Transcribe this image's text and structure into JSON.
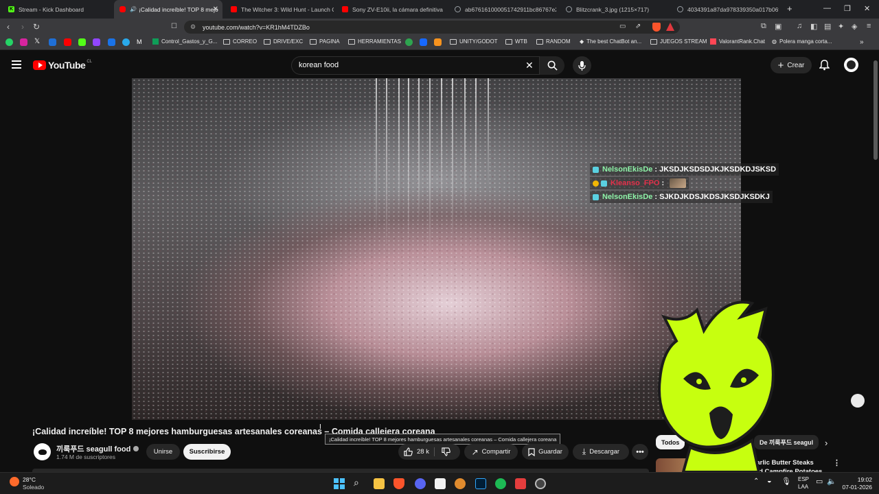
{
  "browser": {
    "tabs": [
      {
        "label": "Stream - Kick Dashboard",
        "favicon": "kick-icon",
        "color": "#53fc18"
      },
      {
        "label": "¡Calidad increíble! TOP 8 mejo",
        "favicon": "youtube-icon",
        "color": "#ff0000",
        "active": true
      },
      {
        "label": "The Witcher 3: Wild Hunt - Launch C",
        "favicon": "youtube-icon",
        "color": "#ff0000"
      },
      {
        "label": "Sony ZV-E10ii, la cámara definitiva p",
        "favicon": "youtube-icon",
        "color": "#ff0000"
      },
      {
        "label": "ab676161000051742911bc86767e2",
        "favicon": "globe-icon",
        "color": "#9aa0a6"
      },
      {
        "label": "Blitzcrank_3.jpg (1215×717)",
        "favicon": "globe-icon",
        "color": "#9aa0a6"
      },
      {
        "label": "4034391a87da978339350a017b06f",
        "favicon": "globe-icon",
        "color": "#9aa0a6"
      }
    ],
    "url": "youtube.com/watch?v=KR1hM4TDZBo",
    "bookmarks": [
      {
        "label": "Control_Gastos_y_G...",
        "type": "sheet"
      },
      {
        "label": "CORREO",
        "type": "folder"
      },
      {
        "label": "DRIVE/EXC",
        "type": "folder"
      },
      {
        "label": "PAGINA",
        "type": "folder"
      },
      {
        "label": "HERRAMIENTAS",
        "type": "folder"
      },
      {
        "label": "UNITY/GODOT",
        "type": "folder"
      },
      {
        "label": "WTB",
        "type": "folder"
      },
      {
        "label": "RANDOM",
        "type": "folder"
      },
      {
        "label": "The best ChatBot an...",
        "type": "link"
      },
      {
        "label": "JUEGOS STREAM",
        "type": "folder"
      },
      {
        "label": "ValorantRank.Chat",
        "type": "link"
      },
      {
        "label": "Polera manga corta...",
        "type": "link"
      }
    ]
  },
  "youtube": {
    "logo": "YouTube",
    "country": "CL",
    "search_value": "korean food",
    "create_label": "Crear",
    "brand_color": "#ff0000"
  },
  "chat": [
    {
      "user": "NelsonEkisDe",
      "msg": ": JKSDJKSDSDJKJKSDKDJSKSD",
      "color": "#8ef3a8"
    },
    {
      "user": "Kleanso_FPO",
      "msg": ":",
      "color": "#e3304a"
    },
    {
      "user": "NelsonEkisDe",
      "msg": ": SJKDJKDSJKDSJKSDJKSDKJ",
      "color": "#8ef3a8"
    }
  ],
  "video": {
    "title": "¡Calidad increíble! TOP 8 mejores hamburguesas artesanales coreanas – Comida callejera coreana",
    "tooltip": "¡Calidad increíble! TOP 8 mejores hamburguesas artesanales coreanas – Comida callejera coreana",
    "channel": "끼룩푸드 seagull food",
    "subscribers": "1.74 M de suscriptores",
    "join_label": "Unirse",
    "subscribe_label": "Suscribirse",
    "likes": "28 k",
    "share_label": "Compartir",
    "save_label": "Guardar",
    "download_label": "Descargar"
  },
  "sidebar": {
    "chips": [
      "Todos",
      "De 끼룩푸드 seagul"
    ],
    "next_video_title": "Garlic Butter Steaks and Campfire Potatoes"
  },
  "taskbar": {
    "temp": "28°C",
    "weather": "Soleado",
    "lang1": "ESP",
    "lang2": "LAA",
    "time": "19:02",
    "date": "07-01-2026"
  }
}
